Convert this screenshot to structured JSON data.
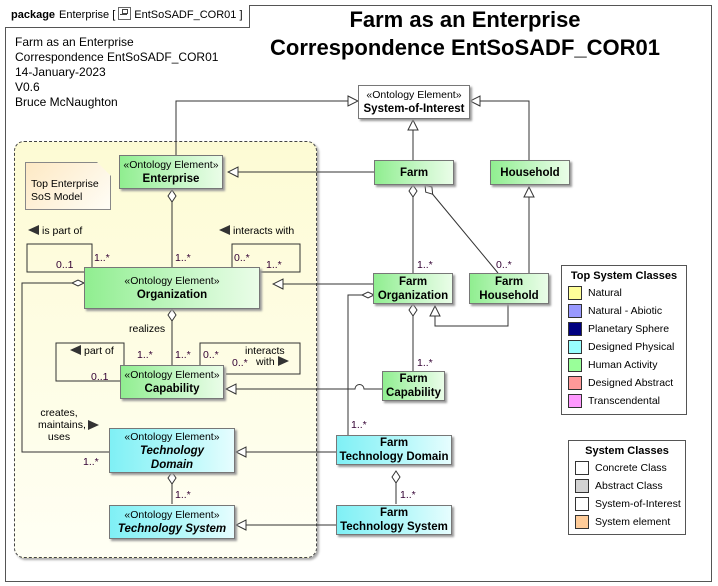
{
  "package": {
    "keyword": "package",
    "name": "Enterprise",
    "diagram_icon": "class-diagram-icon",
    "diagram_name": "EntSoSADF_COR01"
  },
  "meta": {
    "lines": [
      "Farm as an Enterprise",
      "Correspondence EntSoSADF_COR01",
      "14-January-2023",
      "V0.6",
      "Bruce McNaughton"
    ]
  },
  "title": {
    "line1": "Farm as an Enterprise",
    "line2": "Correspondence EntSoSADF_COR01"
  },
  "note": {
    "line1": "Top Enterprise",
    "line2": "SoS Model"
  },
  "stereotype": "«Ontology Element»",
  "nodes": {
    "system_of_interest": "System-of-Interest",
    "enterprise": "Enterprise",
    "organization": "Organization",
    "capability": "Capability",
    "technology_domain_l1": "Technology",
    "technology_domain_l2": "Domain",
    "technology_system": "Technology System",
    "farm": "Farm",
    "household": "Household",
    "farm_organization_l1": "Farm",
    "farm_organization_l2": "Organization",
    "farm_household_l1": "Farm",
    "farm_household_l2": "Household",
    "farm_capability_l1": "Farm",
    "farm_capability_l2": "Capability",
    "farm_technology_domain_l1": "Farm",
    "farm_technology_domain_l2": "Technology Domain",
    "farm_technology_system_l1": "Farm",
    "farm_technology_system_l2": "Technology System"
  },
  "labels": {
    "is_part_of": "is part of",
    "interacts_with": "interacts with",
    "realizes": "realizes",
    "part_of": "part of",
    "interacts": "interacts",
    "with": "with",
    "creates": "creates,",
    "maintains": "maintains,",
    "uses": "uses"
  },
  "multiplicities": {
    "ent_org": "1..*",
    "org_self_part_target": "1..*",
    "org_self_part_source": "0..1",
    "org_interacts_a": "0..*",
    "org_interacts_b": "1..*",
    "org_cap": "1..*",
    "cap_part_target": "1..*",
    "cap_part_source": "0..1",
    "cap_interacts_a": "0..*",
    "cap_interacts_b": "0..*",
    "org_techdomain": "1..*",
    "techdomain_techsystem": "1..*",
    "farm_farmorg": "1..*",
    "farm_farmhousehold": "0..*",
    "farmorg_farmcap": "1..*",
    "farmorg_farmtechdomain": "1..*",
    "farmtechdomain_farmtechsystem": "1..*"
  },
  "legend_top": {
    "title": "Top System Classes",
    "items": [
      {
        "label": "Natural",
        "color": "#ffff99"
      },
      {
        "label": "Natural - Abiotic",
        "color": "#9999ff"
      },
      {
        "label": "Planetary Sphere",
        "color": "#000080"
      },
      {
        "label": "Designed Physical",
        "color": "#99ffff"
      },
      {
        "label": "Human Activity",
        "color": "#99ff99"
      },
      {
        "label": "Designed Abstract",
        "color": "#ff9999"
      },
      {
        "label": "Transcendental",
        "color": "#ff99ff"
      }
    ]
  },
  "legend_system": {
    "title": "System Classes",
    "items": [
      {
        "label": "Concrete Class",
        "color": "#ffffff"
      },
      {
        "label": "Abstract Class",
        "color": "#d3d3d3"
      },
      {
        "label": "System-of-Interest",
        "color": "#ffffff"
      },
      {
        "label": "System element",
        "color": "#ffcc99"
      }
    ]
  }
}
